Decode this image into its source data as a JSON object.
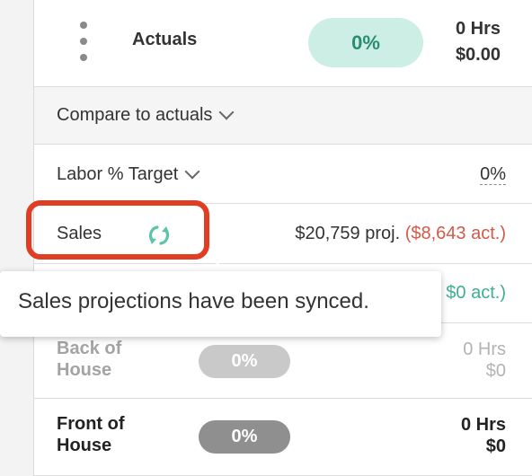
{
  "header": {
    "title": "Actuals",
    "percent": "0%",
    "hours": "0 Hrs",
    "cost": "$0.00"
  },
  "compare": {
    "label": "Compare to actuals"
  },
  "labor_target": {
    "label": "Labor % Target",
    "value": "0%"
  },
  "sales": {
    "label": "Sales",
    "projected": "$20,759 proj.",
    "actual": "($8,643 act.)",
    "sync_icon": "sync-icon"
  },
  "hidden_row": {
    "actual_partial": "$0 act.)"
  },
  "back_of_house": {
    "label": "Back of House",
    "percent": "0%",
    "hours": "0 Hrs",
    "cost": "$0"
  },
  "front_of_house": {
    "label": "Front of House",
    "percent": "0%",
    "hours": "0 Hrs",
    "cost": "$0"
  },
  "tooltip": {
    "text": "Sales projections have been synced."
  },
  "colors": {
    "accent_teal": "#2a8c74",
    "pill_teal_bg": "#cdeee5",
    "highlight_red": "#e03d23",
    "actual_red": "#d25a48"
  }
}
